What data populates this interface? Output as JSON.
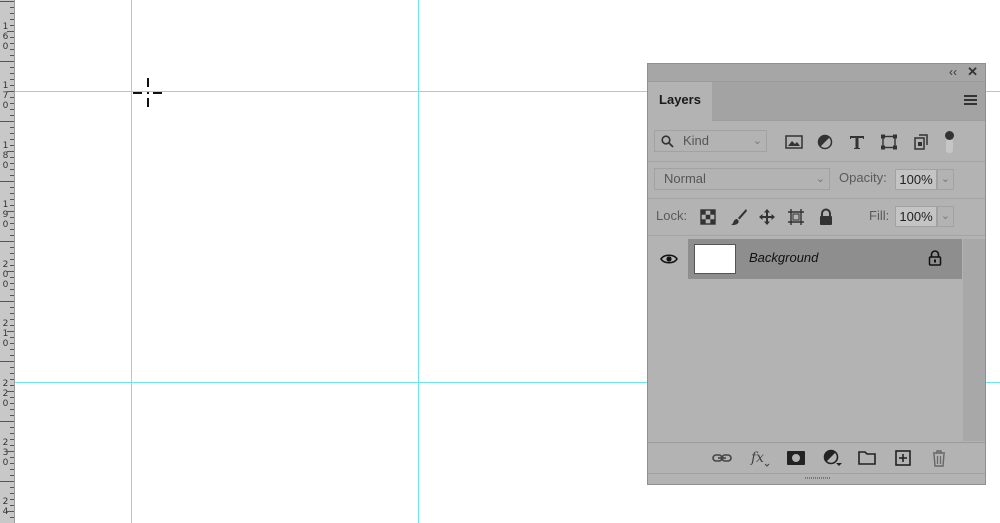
{
  "ruler": {
    "labels": [
      "160",
      "170",
      "180",
      "190",
      "200",
      "210",
      "220",
      "230",
      "24"
    ]
  },
  "panel": {
    "tab_label": "Layers",
    "filter": {
      "kind_label": "Kind"
    },
    "blend": {
      "mode": "Normal",
      "opacity_label": "Opacity:",
      "opacity_value": "100%"
    },
    "lock": {
      "label": "Lock:",
      "fill_label": "Fill:",
      "fill_value": "100%"
    },
    "layers": [
      {
        "name": "Background",
        "visible": true,
        "locked": true
      }
    ]
  },
  "colors": {
    "guide": "#6ee6ee",
    "panel_bg": "#b3b3b3",
    "selected_layer": "#8e8e8e"
  },
  "icons": {
    "collapse": "double-chevron-left-icon",
    "close": "close-icon",
    "panel_menu": "hamburger-icon"
  }
}
